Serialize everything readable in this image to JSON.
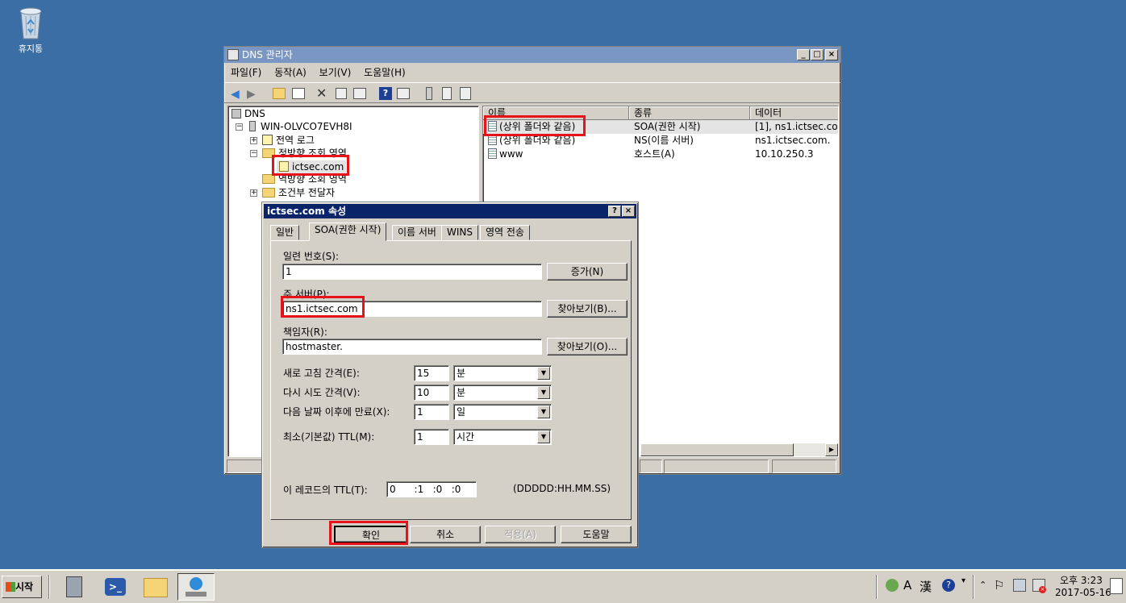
{
  "desktop": {
    "recycle_label": "휴지통"
  },
  "main_window": {
    "title": "DNS 관리자",
    "menu": [
      "파일(F)",
      "동작(A)",
      "보기(V)",
      "도움말(H)"
    ],
    "tree": {
      "root": "DNS",
      "server": "WIN-OLVCO7EVH8I",
      "global_log": "전역 로그",
      "forward_zone": "정방향 조회 영역",
      "zone": "ictsec.com",
      "reverse_zone": "역방향 조회 영역",
      "conditional": "조건부 전달자"
    },
    "list": {
      "columns": [
        "이름",
        "종류",
        "데이터"
      ],
      "rows": [
        {
          "name": "(상위 폴더와 같음)",
          "type": "SOA(권한 시작)",
          "data": "[1], ns1.ictsec.co"
        },
        {
          "name": "(상위 폴더와 같음)",
          "type": "NS(이름 서버)",
          "data": "ns1.ictsec.com."
        },
        {
          "name": "www",
          "type": "호스트(A)",
          "data": "10.10.250.3"
        }
      ]
    }
  },
  "dialog": {
    "title": "ictsec.com 속성",
    "help_btn": "?",
    "close_btn": "×",
    "tabs": [
      "일반",
      "SOA(권한 시작)",
      "이름 서버",
      "WINS",
      "영역 전송"
    ],
    "serial_label": "일련 번호(S):",
    "serial_value": "1",
    "increment_btn": "증가(N)",
    "primary_label": "주 서버(P):",
    "primary_value": "ns1.ictsec.com",
    "browse_b": "찾아보기(B)...",
    "responsible_label": "책임자(R):",
    "responsible_value": "hostmaster.",
    "browse_o": "찾아보기(O)...",
    "refresh_label": "새로 고침 간격(E):",
    "refresh_value": "15",
    "refresh_unit": "분",
    "retry_label": "다시 시도 간격(V):",
    "retry_value": "10",
    "retry_unit": "분",
    "expire_label": "다음 날짜 이후에 만료(X):",
    "expire_value": "1",
    "expire_unit": "일",
    "min_ttl_label": "최소(기본값) TTL(M):",
    "min_ttl_value": "1",
    "min_ttl_unit": "시간",
    "ttl_label": "이 레코드의 TTL(T):",
    "ttl_value": "0      :1   :0   :0",
    "ttl_format": "(DDDDD:HH.MM.SS)",
    "ok": "확인",
    "cancel": "취소",
    "apply": "적용(A)",
    "help": "도움말"
  },
  "taskbar": {
    "start": "시작",
    "time": "오후 3:23",
    "date": "2017-05-16",
    "ime_a": "A",
    "ime_han": "漢"
  }
}
